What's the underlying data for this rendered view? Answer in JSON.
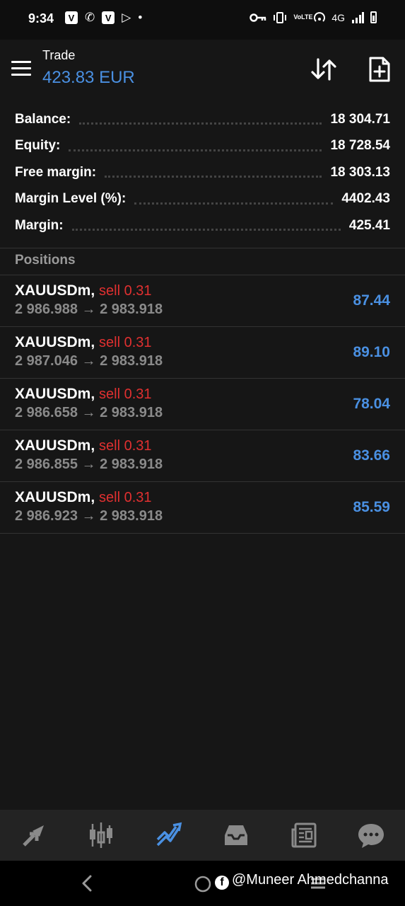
{
  "status_bar": {
    "time": "9:34",
    "network": "4G",
    "volte": "VoLTE"
  },
  "header": {
    "title": "Trade",
    "amount": "423.83 EUR"
  },
  "summary": [
    {
      "label": "Balance:",
      "value": "18 304.71"
    },
    {
      "label": "Equity:",
      "value": "18 728.54"
    },
    {
      "label": "Free margin:",
      "value": "18 303.13"
    },
    {
      "label": "Margin Level (%):",
      "value": "4402.43"
    },
    {
      "label": "Margin:",
      "value": "425.41"
    }
  ],
  "positions_title": "Positions",
  "positions": [
    {
      "symbol": "XAUUSDm,",
      "side": "sell 0.31",
      "open": "2 986.988",
      "arrow": "→",
      "current": "2 983.918",
      "profit": "87.44"
    },
    {
      "symbol": "XAUUSDm,",
      "side": "sell 0.31",
      "open": "2 987.046",
      "arrow": "→",
      "current": "2 983.918",
      "profit": "89.10"
    },
    {
      "symbol": "XAUUSDm,",
      "side": "sell 0.31",
      "open": "2 986.658",
      "arrow": "→",
      "current": "2 983.918",
      "profit": "78.04"
    },
    {
      "symbol": "XAUUSDm,",
      "side": "sell 0.31",
      "open": "2 986.855",
      "arrow": "→",
      "current": "2 983.918",
      "profit": "83.66"
    },
    {
      "symbol": "XAUUSDm,",
      "side": "sell 0.31",
      "open": "2 986.923",
      "arrow": "→",
      "current": "2 983.918",
      "profit": "85.59"
    }
  ],
  "bottom_nav": [
    {
      "icon": "quotes-icon",
      "active": false
    },
    {
      "icon": "chart-icon",
      "active": false
    },
    {
      "icon": "trade-icon",
      "active": true
    },
    {
      "icon": "history-icon",
      "active": false
    },
    {
      "icon": "news-icon",
      "active": false
    },
    {
      "icon": "chat-icon",
      "active": false
    }
  ],
  "watermark": "@Muneer Ahmedchanna",
  "colors": {
    "accent": "#4a90e2",
    "sell": "#e03030",
    "background": "#161616",
    "muted": "#8a8a8a"
  }
}
